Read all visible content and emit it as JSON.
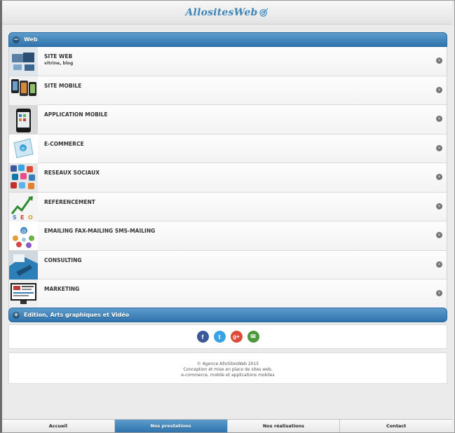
{
  "header": {
    "logo_text": "AllositesWeb"
  },
  "sections": [
    {
      "title": "Web",
      "expanded": true,
      "items": [
        {
          "title": "SITE WEB",
          "subtitle": "vitrine, blog",
          "icon": "website-thumbnail"
        },
        {
          "title": "SITE MOBILE",
          "subtitle": "",
          "icon": "mobile-site-thumbnail"
        },
        {
          "title": "APPLICATION MOBILE",
          "subtitle": "",
          "icon": "mobile-app-thumbnail"
        },
        {
          "title": "E-COMMERCE",
          "subtitle": "",
          "icon": "ecommerce-thumbnail"
        },
        {
          "title": "RESEAUX SOCIAUX",
          "subtitle": "",
          "icon": "social-networks-thumbnail"
        },
        {
          "title": "REFERENCEMENT",
          "subtitle": "",
          "icon": "seo-thumbnail"
        },
        {
          "title": "EMAILING FAX-MAILING SMS-MAILING",
          "subtitle": "",
          "icon": "emailing-thumbnail"
        },
        {
          "title": "CONSULTING",
          "subtitle": "",
          "icon": "consulting-thumbnail"
        },
        {
          "title": "MARKETING",
          "subtitle": "",
          "icon": "marketing-thumbnail"
        }
      ]
    },
    {
      "title": "Edition, Arts graphiques et Vidéo",
      "expanded": false
    }
  ],
  "social": [
    {
      "name": "facebook",
      "glyph": "f",
      "color": "#3b5998"
    },
    {
      "name": "twitter",
      "glyph": "t",
      "color": "#3aa3e3"
    },
    {
      "name": "google-plus",
      "glyph": "g+",
      "color": "#dd4b39"
    },
    {
      "name": "email",
      "glyph": "✉",
      "color": "#4a9a3a"
    }
  ],
  "footer": {
    "line1": "© Agence AlloSitesWeb 2015",
    "line2": "Conception et mise en place de sites web,",
    "line3": "e-commerce, mobile et applications mobiles"
  },
  "navbar": [
    {
      "label": "Accueil",
      "active": false
    },
    {
      "label": "Nos prestations",
      "active": true
    },
    {
      "label": "Nos réalisations",
      "active": false
    },
    {
      "label": "Contact",
      "active": false
    }
  ],
  "colors": {
    "accent": "#3a7fba",
    "logo": "#3f86b8"
  }
}
